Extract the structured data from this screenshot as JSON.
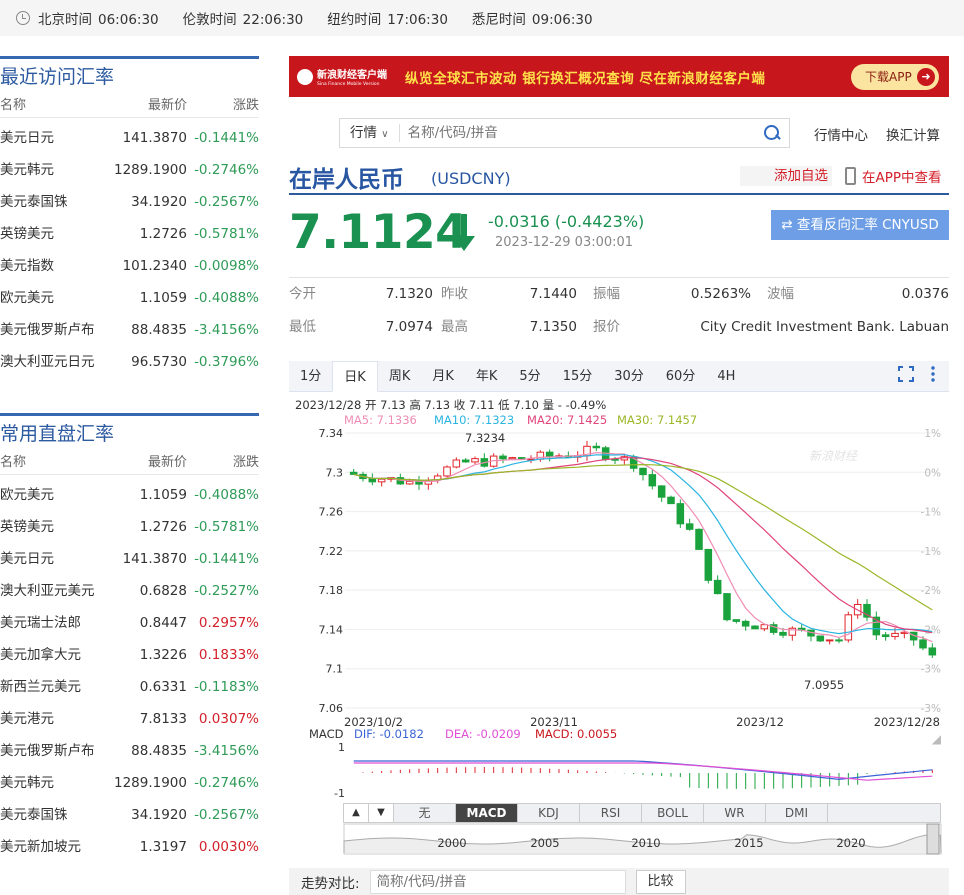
{
  "clocks": [
    {
      "city": "北京时间",
      "time": "06:06:30"
    },
    {
      "city": "伦敦时间",
      "time": "22:06:30"
    },
    {
      "city": "纽约时间",
      "time": "17:06:30"
    },
    {
      "city": "悉尼时间",
      "time": "09:06:30"
    }
  ],
  "recent": {
    "title": "最近访问汇率",
    "headers": [
      "名称",
      "最新价",
      "涨跌"
    ],
    "rows": [
      [
        "美元日元",
        "141.3870",
        "-0.1441%",
        "g"
      ],
      [
        "美元韩元",
        "1289.1900",
        "-0.2746%",
        "g"
      ],
      [
        "美元泰国铢",
        "34.1920",
        "-0.2567%",
        "g"
      ],
      [
        "英镑美元",
        "1.2726",
        "-0.5781%",
        "g"
      ],
      [
        "美元指数",
        "101.2340",
        "-0.0098%",
        "g"
      ],
      [
        "欧元美元",
        "1.1059",
        "-0.4088%",
        "g"
      ],
      [
        "美元俄罗斯卢布",
        "88.4835",
        "-3.4156%",
        "g"
      ],
      [
        "澳大利亚元日元",
        "96.5730",
        "-0.3796%",
        "g"
      ]
    ]
  },
  "common": {
    "title": "常用直盘汇率",
    "headers": [
      "名称",
      "最新价",
      "涨跌"
    ],
    "rows": [
      [
        "欧元美元",
        "1.1059",
        "-0.4088%",
        "g"
      ],
      [
        "英镑美元",
        "1.2726",
        "-0.5781%",
        "g"
      ],
      [
        "美元日元",
        "141.3870",
        "-0.1441%",
        "g"
      ],
      [
        "澳大利亚元美元",
        "0.6828",
        "-0.2527%",
        "g"
      ],
      [
        "美元瑞士法郎",
        "0.8447",
        "0.2957%",
        "r"
      ],
      [
        "美元加拿大元",
        "1.3226",
        "0.1833%",
        "r"
      ],
      [
        "新西兰元美元",
        "0.6331",
        "-0.1183%",
        "g"
      ],
      [
        "美元港元",
        "7.8133",
        "0.0307%",
        "r"
      ],
      [
        "美元俄罗斯卢布",
        "88.4835",
        "-3.4156%",
        "g"
      ],
      [
        "美元韩元",
        "1289.1900",
        "-0.2746%",
        "g"
      ],
      [
        "美元泰国铢",
        "34.1920",
        "-0.2567%",
        "g"
      ],
      [
        "美元新加坡元",
        "1.3197",
        "0.0030%",
        "r"
      ]
    ]
  },
  "banner": {
    "brand": "新浪财经客户端",
    "brand_en": "Sina Finance Mobile Version",
    "slogan": "纵览全球汇市波动  银行换汇概况查询  尽在新浪财经客户端",
    "download": "下载APP"
  },
  "search": {
    "select": "行情",
    "placeholder": "名称/代码/拼音"
  },
  "links": {
    "center": "行情中心",
    "calc": "换汇计算"
  },
  "quote": {
    "name": "在岸人民币",
    "code": "(USDCNY)",
    "add": "添加自选",
    "app": "在APP中查看",
    "price": "7.1124",
    "change": "-0.0316 (-0.4423%)",
    "time": "2023-12-29 03:00:01",
    "reverse": "查看反向汇率 CNYUSD"
  },
  "stats": [
    [
      [
        "今开",
        "7.1320"
      ],
      [
        "昨收",
        "7.1440"
      ],
      [
        "振幅",
        "0.5263%"
      ],
      [
        "波幅",
        "0.0376"
      ]
    ],
    [
      [
        "最低",
        "7.0974"
      ],
      [
        "最高",
        "7.1350"
      ],
      [
        "报价",
        "City Credit Investment Bank. Labuan"
      ]
    ]
  ],
  "tabs": [
    "1分",
    "日K",
    "周K",
    "月K",
    "年K",
    "5分",
    "15分",
    "30分",
    "60分",
    "4H"
  ],
  "active_tab": "日K",
  "kinfo": "2023/12/28 开 7.13 高 7.13 收 7.11 低 7.10 量 - -0.49%",
  "ma": [
    {
      "t": "MA5: 7.1336",
      "c": "#f08cb4"
    },
    {
      "t": "MA10: 7.1323",
      "c": "#2ab4e0"
    },
    {
      "t": "MA20: 7.1425",
      "c": "#e0457b"
    },
    {
      "t": "MA30: 7.1457",
      "c": "#9ab728"
    }
  ],
  "chart_data": {
    "type": "candlestick",
    "y_ticks": [
      "7.34",
      "7.3",
      "7.26",
      "7.22",
      "7.18",
      "7.14",
      "7.1",
      "7.06"
    ],
    "pct_ticks": [
      "1%",
      "0%",
      "-1%",
      "-1%",
      "-2%",
      "-2%",
      "-3%",
      "-3%"
    ],
    "x_ticks": [
      "2023/10/2",
      "2023/11",
      "2023/12",
      "2023/12/28"
    ],
    "high_label": "7.3234",
    "low_label": "7.0955",
    "ylim": [
      7.06,
      7.34
    ]
  },
  "macd": {
    "label": "MACD",
    "dif": "DIF: -0.0182",
    "dea": "DEA: -0.0209",
    "macd": "MACD: 0.0055",
    "ticks": [
      "1",
      "-1"
    ]
  },
  "indicators": [
    "无",
    "MACD",
    "KDJ",
    "RSI",
    "BOLL",
    "WR",
    "DMI"
  ],
  "active_indicator": "MACD",
  "years": [
    "2000",
    "2005",
    "2010",
    "2015",
    "2020"
  ],
  "compare": {
    "label": "走势对比:",
    "placeholder": "简称/代码/拼音",
    "button": "比较"
  }
}
